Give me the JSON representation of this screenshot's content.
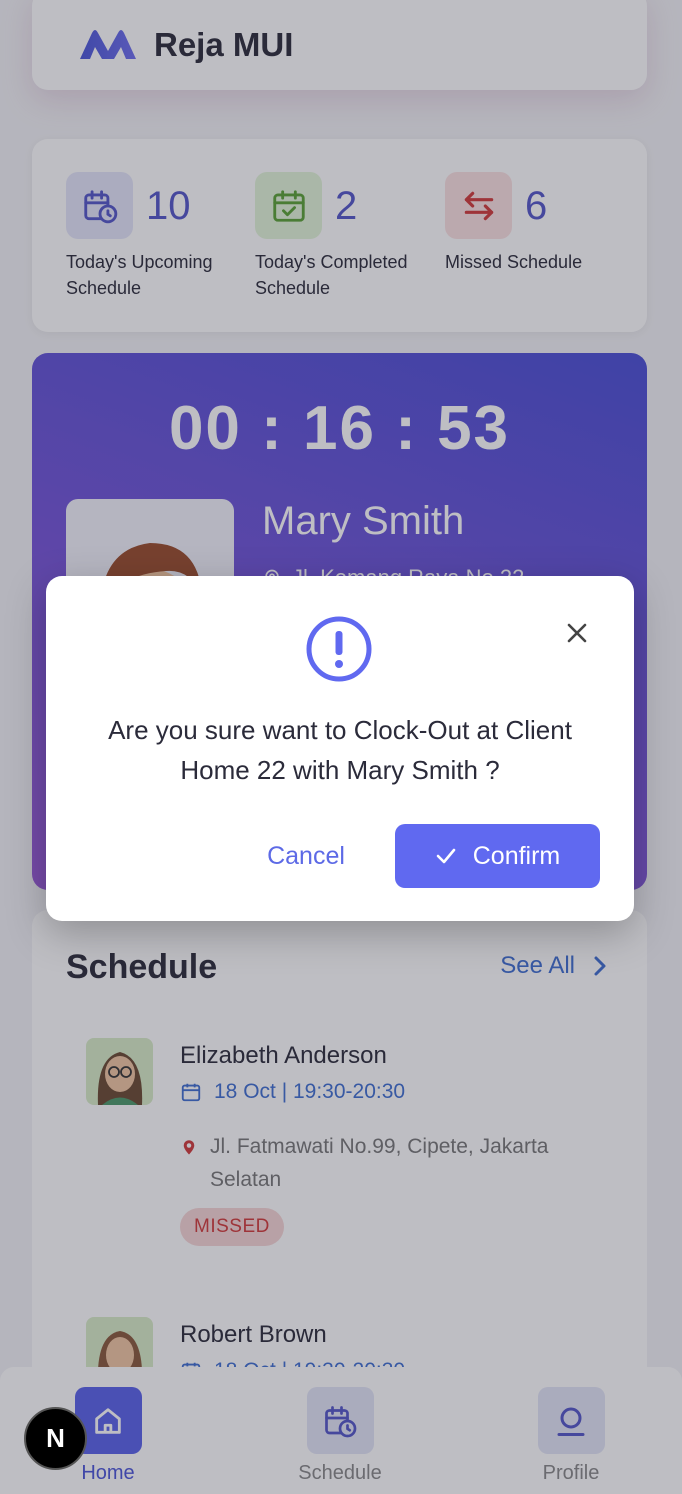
{
  "app": {
    "title": "Reja MUI",
    "logo_icon": "m-logo-icon",
    "brand_color": "#5457c9"
  },
  "stats": [
    {
      "icon": "calendar-clock-icon",
      "value": "10",
      "label": "Today's Upcoming Schedule",
      "bg": "#e4e6fa",
      "color": "#5457c9"
    },
    {
      "icon": "calendar-check-icon",
      "value": "2",
      "label": "Today's Completed Schedule",
      "bg": "#e3f5d9",
      "color": "#5aa334"
    },
    {
      "icon": "swap-arrows-icon",
      "value": "6",
      "label": "Missed Schedule",
      "bg": "#fbe1e1",
      "color": "#d23a3a"
    }
  ],
  "clock": {
    "timer": "00 : 16 : 53",
    "client_name": "Mary Smith",
    "address": "Jl. Kemang Raya No.22"
  },
  "schedule": {
    "title": "Schedule",
    "see_all": "See All",
    "items": [
      {
        "name": "Elizabeth Anderson",
        "date": "18 Oct | 19:30-20:30",
        "address": "Jl. Fatmawati No.99, Cipete, Jakarta Selatan",
        "status": "MISSED"
      },
      {
        "name": "Robert Brown",
        "date": "18 Oct | 19:30-20:30"
      }
    ]
  },
  "nav": {
    "items": [
      {
        "label": "Home",
        "icon": "home-icon",
        "active": true
      },
      {
        "label": "Schedule",
        "icon": "calendar-clock-icon",
        "active": false
      },
      {
        "label": "Profile",
        "icon": "profile-icon",
        "active": false
      }
    ]
  },
  "dev_badge": "N",
  "modal": {
    "icon": "exclamation-circle-icon",
    "message": "Are you sure want to Clock-Out at Client Home 22 with Mary Smith ?",
    "cancel_label": "Cancel",
    "confirm_label": "Confirm",
    "accent": "#6069f0"
  }
}
